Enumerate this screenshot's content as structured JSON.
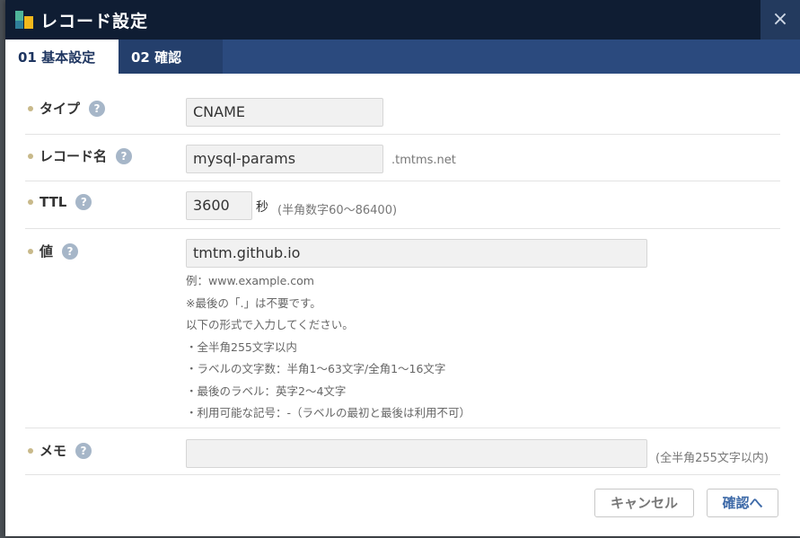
{
  "dialog": {
    "title": "レコード設定",
    "close_glyph": "×"
  },
  "tabs": [
    {
      "label": "01 基本設定",
      "active": true
    },
    {
      "label": "02 確認",
      "active": false
    }
  ],
  "fields": {
    "type": {
      "label": "タイプ",
      "value": "CNAME"
    },
    "record_name": {
      "label": "レコード名",
      "value": "mysql-params",
      "suffix": ".tmtms.net"
    },
    "ttl": {
      "label": "TTL",
      "value": "3600",
      "unit": "秒",
      "hint": "(半角数字60〜86400)"
    },
    "value": {
      "label": "値",
      "value": "tmtm.github.io",
      "notes": [
        "例：www.example.com",
        "※最後の「.」は不要です。",
        "以下の形式で入力してください。",
        "・全半角255文字以内",
        "・ラベルの文字数：半角1〜63文字/全角1〜16文字",
        "・最後のラベル：英字2〜4文字",
        "・利用可能な記号：-（ラベルの最初と最後は利用不可）"
      ]
    },
    "memo": {
      "label": "メモ",
      "value": "",
      "hint": "(全半角255文字以内)"
    }
  },
  "help_glyph": "?",
  "buttons": {
    "cancel": "キャンセル",
    "confirm": "確認へ"
  },
  "colors": {
    "titlebar": "#0f1d33",
    "tabbar": "#2b4a7e",
    "accent": "#3e6aa8",
    "label_dot": "#c8b98a",
    "help_icon": "#a6b6c8"
  }
}
